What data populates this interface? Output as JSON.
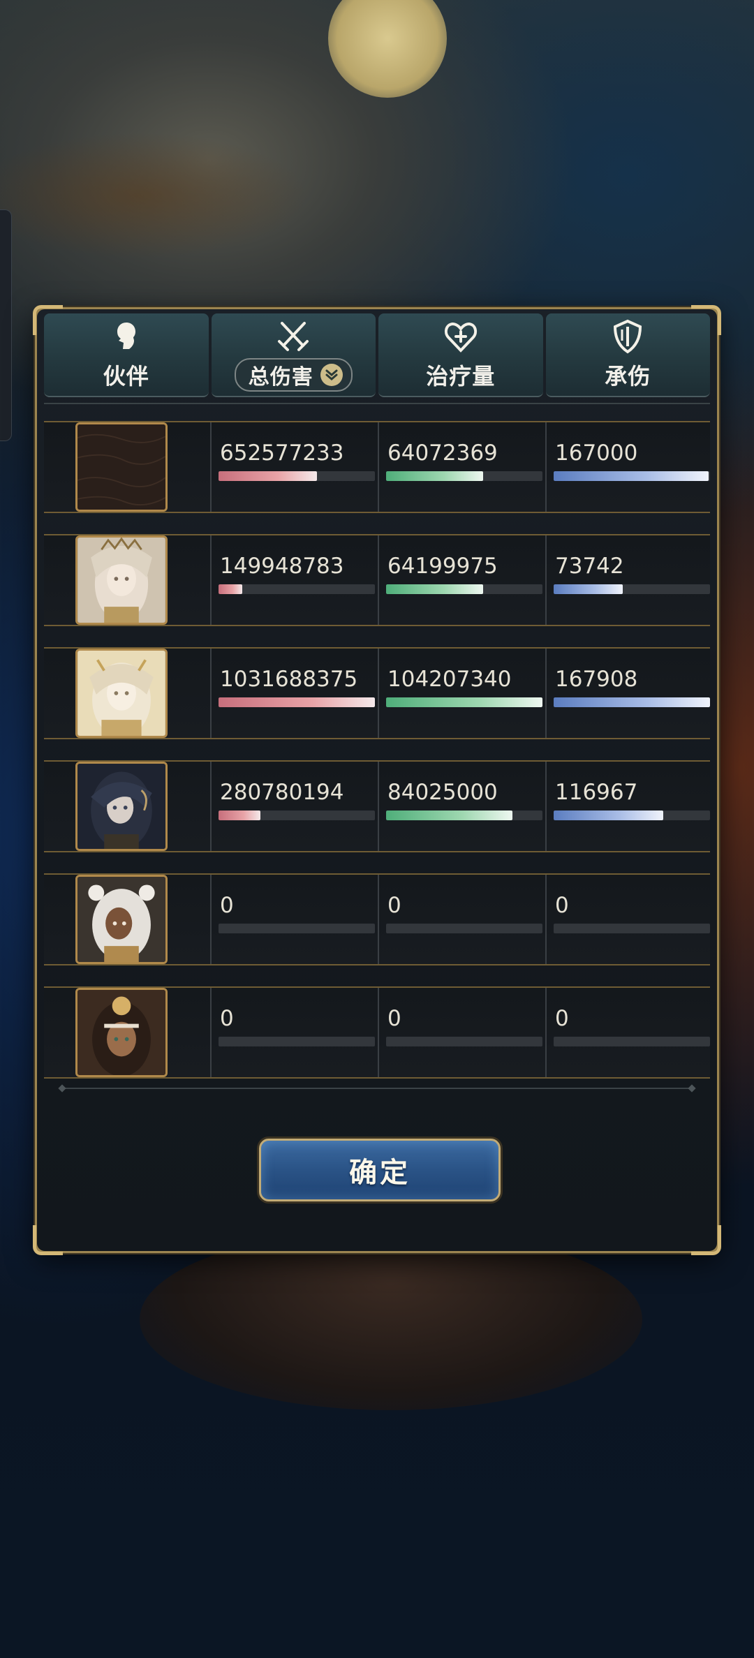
{
  "header": {
    "partner_label": "伙伴",
    "damage_label": "总伤害",
    "heal_label": "治疗量",
    "tank_label": "承伤"
  },
  "rows": [
    {
      "damage": "652577233",
      "heal": "64072369",
      "tank": "167000",
      "damage_fill": 0.63,
      "heal_fill": 0.62,
      "tank_fill": 0.99
    },
    {
      "damage": "149948783",
      "heal": "64199975",
      "tank": "73742",
      "damage_fill": 0.15,
      "heal_fill": 0.62,
      "tank_fill": 0.44
    },
    {
      "damage": "1031688375",
      "heal": "104207340",
      "tank": "167908",
      "damage_fill": 1.0,
      "heal_fill": 1.0,
      "tank_fill": 1.0
    },
    {
      "damage": "280780194",
      "heal": "84025000",
      "tank": "116967",
      "damage_fill": 0.27,
      "heal_fill": 0.81,
      "tank_fill": 0.7
    },
    {
      "damage": "0",
      "heal": "0",
      "tank": "0",
      "damage_fill": 0,
      "heal_fill": 0,
      "tank_fill": 0
    },
    {
      "damage": "0",
      "heal": "0",
      "tank": "0",
      "damage_fill": 0,
      "heal_fill": 0,
      "tank_fill": 0
    }
  ],
  "confirm_label": "确定",
  "colors": {
    "damage_bar": "#c76f7c",
    "heal_bar": "#4fae7a",
    "tank_bar": "#5b7dc0",
    "frame_gold": "#b0894b",
    "button_blue": "#2a5386"
  }
}
